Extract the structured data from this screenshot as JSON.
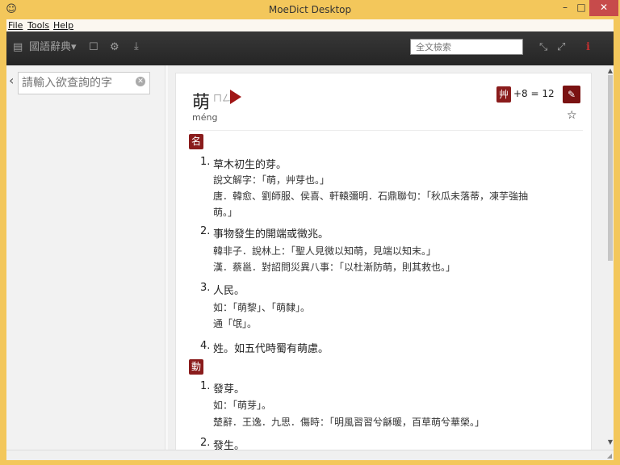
{
  "window": {
    "title": "MoeDict Desktop",
    "icon": "user-icon",
    "minimize": "–",
    "maximize": "□",
    "close": "✕"
  },
  "menu": [
    "File",
    "Tools",
    "Help"
  ],
  "toolbar": {
    "dictionary_label": "國語辭典▾",
    "search_placeholder": "全文檢索",
    "icons": [
      "book-icon",
      "bookmark-icon",
      "settings-icon",
      "download-icon",
      "shrink-icon",
      "expand-icon",
      "info-icon"
    ]
  },
  "sidebar": {
    "query_placeholder": "請輸入欲查詢的字"
  },
  "entry": {
    "character": "萌",
    "bopomofo": "ㄇㄥˊ",
    "pinyin": "méng",
    "radical": "艸",
    "stroke_expression": "+8 = 12",
    "sections": [
      {
        "pos": "名",
        "definitions": [
          {
            "num": "1.",
            "text": "草木初生的芽。",
            "examples": [
              "說文解字：「萌，艸芽也。」",
              "唐．韓愈、劉師服、侯喜、軒轅彌明．石鼎聯句：「秋瓜未落蒂，凍芋強抽",
              "萌。」"
            ]
          },
          {
            "num": "2.",
            "text": "事物發生的開端或徵兆。",
            "examples": [
              "韓非子．說林上：「聖人見微以知萌，見端以知末。」",
              "漢．蔡邕．對詔問災異八事：「以杜漸防萌，則其救也。」"
            ]
          },
          {
            "num": "3.",
            "text": "人民。",
            "examples": [
              "如：「萌黎」、「萌隸」。",
              "通「氓」。"
            ]
          },
          {
            "num": "4.",
            "text": "姓。如五代時蜀有萌慮。",
            "examples": []
          }
        ]
      },
      {
        "pos": "動",
        "definitions": [
          {
            "num": "1.",
            "text": "發芽。",
            "examples": [
              "如：「萌芽」。",
              "楚辭．王逸．九思．傷時：「明風習習兮龢暖，百草萌兮華榮。」"
            ]
          },
          {
            "num": "2.",
            "text": "發生。",
            "examples": []
          }
        ]
      }
    ]
  },
  "colors": {
    "accent": "#8a1c1c",
    "titlebar": "#f3c75b",
    "toolbar": "#2e2e2e"
  }
}
